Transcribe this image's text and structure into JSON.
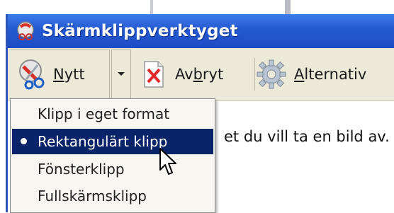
{
  "window": {
    "title": "Skärmklippverktyget",
    "titlebar_color": "#2459d2"
  },
  "toolbar": {
    "new_label_prefix": "",
    "new_label_mnemonic": "N",
    "new_label_rest": "ytt",
    "new_icon": "scissors-icon",
    "dropdown_icon": "chevron-down-icon",
    "cancel_label_prefix": "Av",
    "cancel_label_mnemonic": "b",
    "cancel_label_rest": "ryt",
    "cancel_icon": "close-document-icon",
    "options_label_prefix": "",
    "options_label_mnemonic": "A",
    "options_label_rest": "lternativ",
    "options_icon": "gear-icon"
  },
  "canvas": {
    "instruction_text": "et du vill ta en bild av."
  },
  "menu": {
    "items": [
      {
        "label": "Klipp i eget format",
        "selected": false
      },
      {
        "label": "Rektangulärt klipp",
        "selected": true
      },
      {
        "label": "Fönsterklipp",
        "selected": false
      },
      {
        "label": "Fullskärmsklipp",
        "selected": false
      }
    ],
    "selected_color": "#0a246a"
  }
}
